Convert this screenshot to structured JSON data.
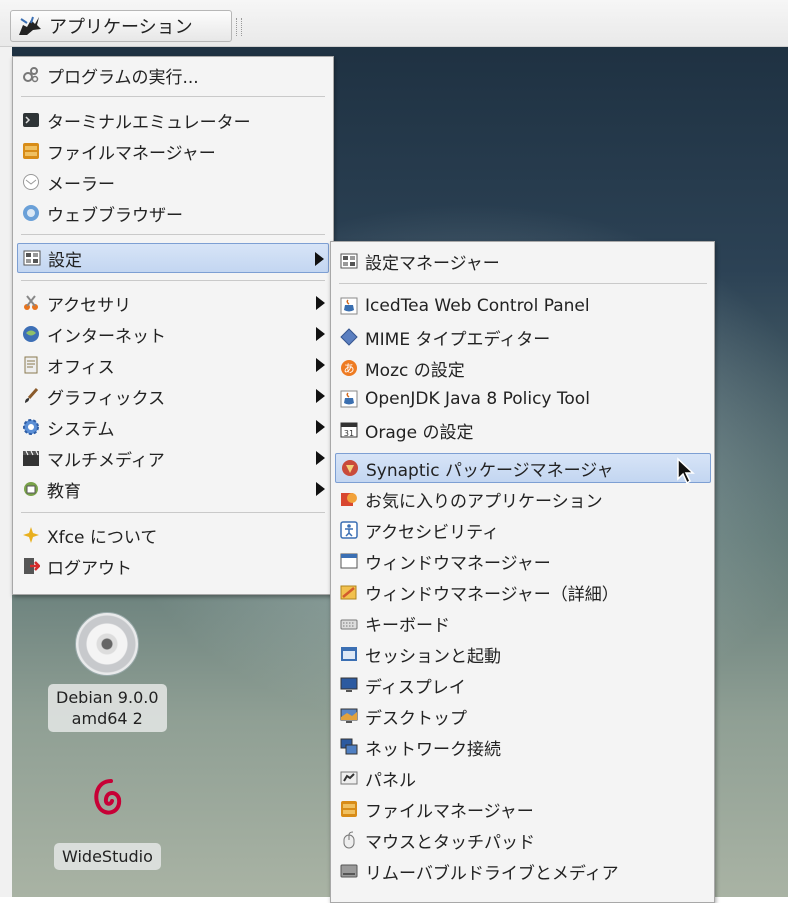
{
  "panel": {
    "app_button_label": "アプリケーション"
  },
  "main_menu": {
    "run_program": "プログラムの実行...",
    "terminal": "ターミナルエミュレーター",
    "file_manager": "ファイルマネージャー",
    "mailer": "メーラー",
    "web_browser": "ウェブブラウザー",
    "settings": "設定",
    "accessories": "アクセサリ",
    "internet": "インターネット",
    "office": "オフィス",
    "graphics": "グラフィックス",
    "system": "システム",
    "multimedia": "マルチメディア",
    "education": "教育",
    "about_xfce": "Xfce について",
    "logout": "ログアウト"
  },
  "settings_menu": {
    "settings_manager": "設定マネージャー",
    "icedtea": "IcedTea Web Control Panel",
    "mime_editor": "MIME タイプエディター",
    "mozc": "Mozc の設定",
    "openjdk_policy": "OpenJDK Java 8 Policy Tool",
    "orage": "Orage の設定",
    "synaptic": "Synaptic パッケージマネージャ",
    "favorites": "お気に入りのアプリケーション",
    "accessibility": "アクセシビリティ",
    "window_manager": "ウィンドウマネージャー",
    "window_manager_tweaks": "ウィンドウマネージャー（詳細）",
    "keyboard": "キーボード",
    "session_startup": "セッションと起動",
    "display": "ディスプレイ",
    "desktop": "デスクトップ",
    "network_connections": "ネットワーク接続",
    "panel": "パネル",
    "file_manager": "ファイルマネージャー",
    "mouse_touchpad": "マウスとタッチパッド",
    "removable_media": "リムーバブルドライブとメディア"
  },
  "desktop_icons": {
    "cdrom_label": "Debian 9.0.0\namd64 2",
    "widestudio_label": "WideStudio"
  },
  "colors": {
    "highlight": "#c8d9f2",
    "highlight_border": "#7d9fd3",
    "menu_bg": "#f4f4f4"
  }
}
